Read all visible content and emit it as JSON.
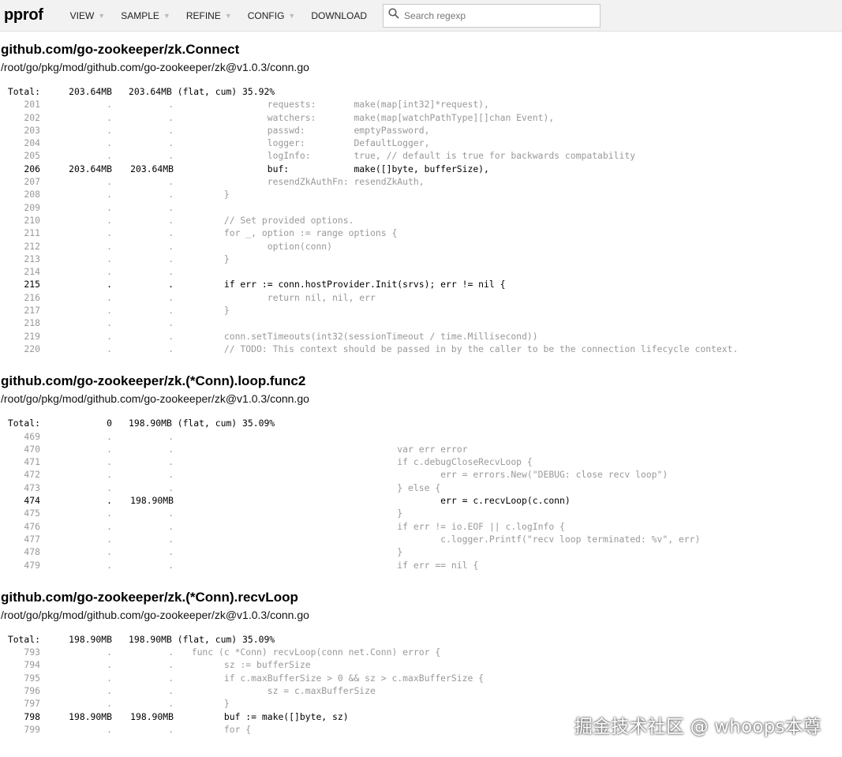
{
  "topbar": {
    "logo": "pprof",
    "menus": [
      "VIEW",
      "SAMPLE",
      "REFINE",
      "CONFIG",
      "DOWNLOAD"
    ],
    "search_placeholder": "Search regexp"
  },
  "blocks": [
    {
      "name": "github.com/go-zookeeper/zk.Connect",
      "path": "/root/go/pkg/mod/github.com/go-zookeeper/zk@v1.0.3/conn.go",
      "total": {
        "label": "Total:",
        "flat": "203.64MB",
        "cum": "203.64MB (flat, cum) 35.92%"
      },
      "lines": [
        {
          "n": "201",
          "flat": ".",
          "cum": ".",
          "src": "                requests:       make(map[int32]*request),"
        },
        {
          "n": "202",
          "flat": ".",
          "cum": ".",
          "src": "                watchers:       make(map[watchPathType][]chan Event),"
        },
        {
          "n": "203",
          "flat": ".",
          "cum": ".",
          "src": "                passwd:         emptyPassword,"
        },
        {
          "n": "204",
          "flat": ".",
          "cum": ".",
          "src": "                logger:         DefaultLogger,"
        },
        {
          "n": "205",
          "flat": ".",
          "cum": ".",
          "src": "                logInfo:        true, // default is true for backwards compatability"
        },
        {
          "n": "206",
          "flat": "203.64MB",
          "cum": "203.64MB",
          "src": "                buf:            make([]byte, bufferSize),",
          "hot": true
        },
        {
          "n": "207",
          "flat": ".",
          "cum": ".",
          "src": "                resendZkAuthFn: resendZkAuth,"
        },
        {
          "n": "208",
          "flat": ".",
          "cum": ".",
          "src": "        }"
        },
        {
          "n": "209",
          "flat": ".",
          "cum": ".",
          "src": ""
        },
        {
          "n": "210",
          "flat": ".",
          "cum": ".",
          "src": "        // Set provided options."
        },
        {
          "n": "211",
          "flat": ".",
          "cum": ".",
          "src": "        for _, option := range options {"
        },
        {
          "n": "212",
          "flat": ".",
          "cum": ".",
          "src": "                option(conn)"
        },
        {
          "n": "213",
          "flat": ".",
          "cum": ".",
          "src": "        }"
        },
        {
          "n": "214",
          "flat": ".",
          "cum": ".",
          "src": ""
        },
        {
          "n": "215",
          "flat": ".",
          "cum": ".",
          "src": "        if err := conn.hostProvider.Init(srvs); err != nil {",
          "hot": true
        },
        {
          "n": "216",
          "flat": ".",
          "cum": ".",
          "src": "                return nil, nil, err"
        },
        {
          "n": "217",
          "flat": ".",
          "cum": ".",
          "src": "        }"
        },
        {
          "n": "218",
          "flat": ".",
          "cum": ".",
          "src": ""
        },
        {
          "n": "219",
          "flat": ".",
          "cum": ".",
          "src": "        conn.setTimeouts(int32(sessionTimeout / time.Millisecond))"
        },
        {
          "n": "220",
          "flat": ".",
          "cum": ".",
          "src": "        // TODO: This context should be passed in by the caller to be the connection lifecycle context."
        }
      ]
    },
    {
      "name": "github.com/go-zookeeper/zk.(*Conn).loop.func2",
      "path": "/root/go/pkg/mod/github.com/go-zookeeper/zk@v1.0.3/conn.go",
      "total": {
        "label": "Total:",
        "flat": "0",
        "cum": "198.90MB (flat, cum) 35.09%"
      },
      "lines": [
        {
          "n": "469",
          "flat": ".",
          "cum": ".",
          "src": ""
        },
        {
          "n": "470",
          "flat": ".",
          "cum": ".",
          "src": "                                        var err error"
        },
        {
          "n": "471",
          "flat": ".",
          "cum": ".",
          "src": "                                        if c.debugCloseRecvLoop {"
        },
        {
          "n": "472",
          "flat": ".",
          "cum": ".",
          "src": "                                                err = errors.New(\"DEBUG: close recv loop\")"
        },
        {
          "n": "473",
          "flat": ".",
          "cum": ".",
          "src": "                                        } else {"
        },
        {
          "n": "474",
          "flat": ".",
          "cum": "198.90MB",
          "src": "                                                err = c.recvLoop(c.conn)",
          "hot": true
        },
        {
          "n": "475",
          "flat": ".",
          "cum": ".",
          "src": "                                        }"
        },
        {
          "n": "476",
          "flat": ".",
          "cum": ".",
          "src": "                                        if err != io.EOF || c.logInfo {"
        },
        {
          "n": "477",
          "flat": ".",
          "cum": ".",
          "src": "                                                c.logger.Printf(\"recv loop terminated: %v\", err)"
        },
        {
          "n": "478",
          "flat": ".",
          "cum": ".",
          "src": "                                        }"
        },
        {
          "n": "479",
          "flat": ".",
          "cum": ".",
          "src": "                                        if err == nil {"
        }
      ]
    },
    {
      "name": "github.com/go-zookeeper/zk.(*Conn).recvLoop",
      "path": "/root/go/pkg/mod/github.com/go-zookeeper/zk@v1.0.3/conn.go",
      "total": {
        "label": "Total:",
        "flat": "198.90MB",
        "cum": "198.90MB (flat, cum) 35.09%"
      },
      "lines": [
        {
          "n": "793",
          "flat": ".",
          "cum": ".",
          "src": "  func (c *Conn) recvLoop(conn net.Conn) error {"
        },
        {
          "n": "794",
          "flat": ".",
          "cum": ".",
          "src": "        sz := bufferSize"
        },
        {
          "n": "795",
          "flat": ".",
          "cum": ".",
          "src": "        if c.maxBufferSize > 0 && sz > c.maxBufferSize {"
        },
        {
          "n": "796",
          "flat": ".",
          "cum": ".",
          "src": "                sz = c.maxBufferSize"
        },
        {
          "n": "797",
          "flat": ".",
          "cum": ".",
          "src": "        }"
        },
        {
          "n": "798",
          "flat": "198.90MB",
          "cum": "198.90MB",
          "src": "        buf := make([]byte, sz)",
          "hot": true
        },
        {
          "n": "799",
          "flat": ".",
          "cum": ".",
          "src": "        for {"
        }
      ]
    }
  ],
  "watermark": "掘金技术社区 @ whoops本尊"
}
